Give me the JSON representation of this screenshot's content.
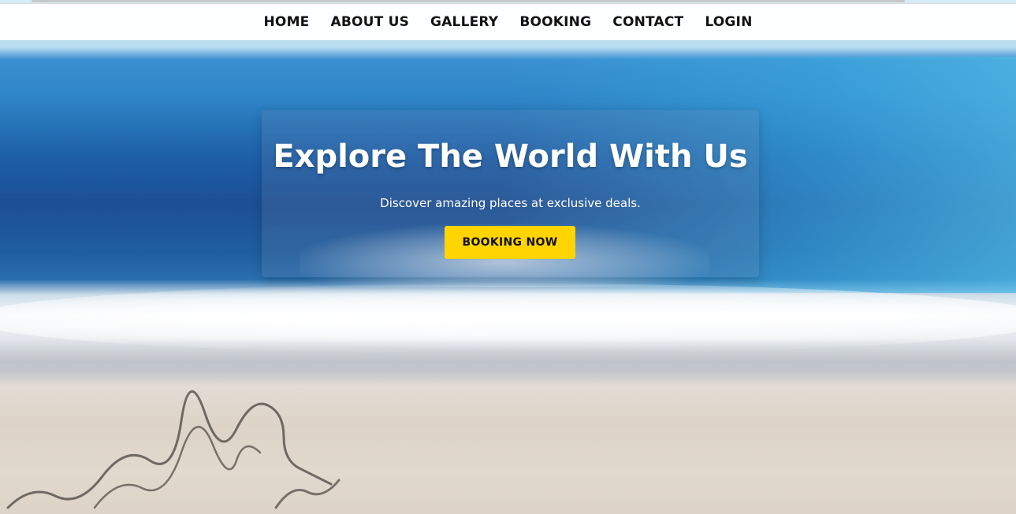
{
  "nav": {
    "items": [
      {
        "label": "HOME"
      },
      {
        "label": "ABOUT US"
      },
      {
        "label": "GALLERY"
      },
      {
        "label": "BOOKING"
      },
      {
        "label": "CONTACT"
      },
      {
        "label": "LOGIN"
      }
    ]
  },
  "hero": {
    "title": "Explore The World With Us",
    "subtitle": "Discover amazing places at exclusive deals.",
    "cta_label": "BOOKING NOW",
    "background": "beach-ocean-photo"
  },
  "colors": {
    "cta": "#ffd400",
    "nav_bg": "#ffffff",
    "nav_text": "#111111",
    "hero_text": "#ffffff"
  }
}
